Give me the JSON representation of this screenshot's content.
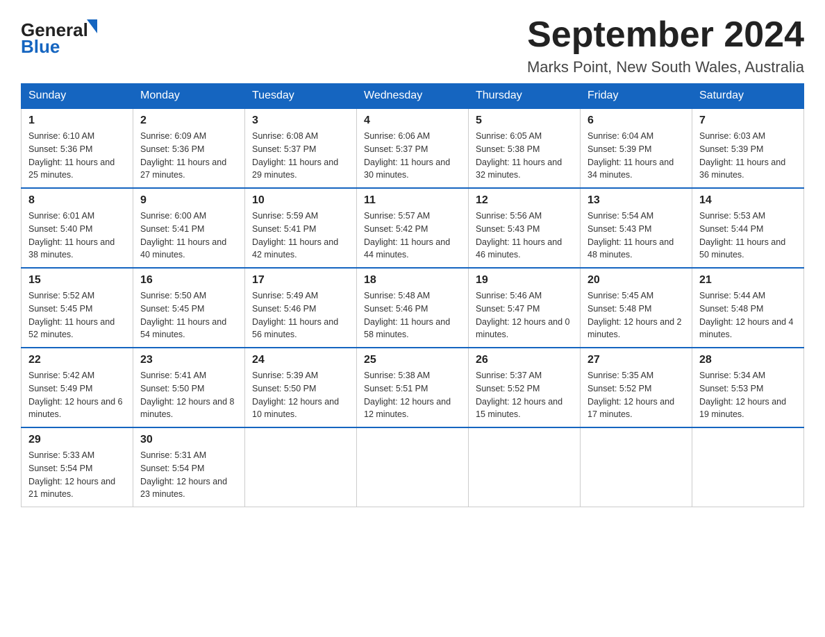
{
  "header": {
    "logo_general": "General",
    "logo_blue": "Blue",
    "month_title": "September 2024",
    "location": "Marks Point, New South Wales, Australia"
  },
  "weekdays": [
    "Sunday",
    "Monday",
    "Tuesday",
    "Wednesday",
    "Thursday",
    "Friday",
    "Saturday"
  ],
  "weeks": [
    [
      {
        "day": "1",
        "sunrise": "6:10 AM",
        "sunset": "5:36 PM",
        "daylight": "11 hours and 25 minutes."
      },
      {
        "day": "2",
        "sunrise": "6:09 AM",
        "sunset": "5:36 PM",
        "daylight": "11 hours and 27 minutes."
      },
      {
        "day": "3",
        "sunrise": "6:08 AM",
        "sunset": "5:37 PM",
        "daylight": "11 hours and 29 minutes."
      },
      {
        "day": "4",
        "sunrise": "6:06 AM",
        "sunset": "5:37 PM",
        "daylight": "11 hours and 30 minutes."
      },
      {
        "day": "5",
        "sunrise": "6:05 AM",
        "sunset": "5:38 PM",
        "daylight": "11 hours and 32 minutes."
      },
      {
        "day": "6",
        "sunrise": "6:04 AM",
        "sunset": "5:39 PM",
        "daylight": "11 hours and 34 minutes."
      },
      {
        "day": "7",
        "sunrise": "6:03 AM",
        "sunset": "5:39 PM",
        "daylight": "11 hours and 36 minutes."
      }
    ],
    [
      {
        "day": "8",
        "sunrise": "6:01 AM",
        "sunset": "5:40 PM",
        "daylight": "11 hours and 38 minutes."
      },
      {
        "day": "9",
        "sunrise": "6:00 AM",
        "sunset": "5:41 PM",
        "daylight": "11 hours and 40 minutes."
      },
      {
        "day": "10",
        "sunrise": "5:59 AM",
        "sunset": "5:41 PM",
        "daylight": "11 hours and 42 minutes."
      },
      {
        "day": "11",
        "sunrise": "5:57 AM",
        "sunset": "5:42 PM",
        "daylight": "11 hours and 44 minutes."
      },
      {
        "day": "12",
        "sunrise": "5:56 AM",
        "sunset": "5:43 PM",
        "daylight": "11 hours and 46 minutes."
      },
      {
        "day": "13",
        "sunrise": "5:54 AM",
        "sunset": "5:43 PM",
        "daylight": "11 hours and 48 minutes."
      },
      {
        "day": "14",
        "sunrise": "5:53 AM",
        "sunset": "5:44 PM",
        "daylight": "11 hours and 50 minutes."
      }
    ],
    [
      {
        "day": "15",
        "sunrise": "5:52 AM",
        "sunset": "5:45 PM",
        "daylight": "11 hours and 52 minutes."
      },
      {
        "day": "16",
        "sunrise": "5:50 AM",
        "sunset": "5:45 PM",
        "daylight": "11 hours and 54 minutes."
      },
      {
        "day": "17",
        "sunrise": "5:49 AM",
        "sunset": "5:46 PM",
        "daylight": "11 hours and 56 minutes."
      },
      {
        "day": "18",
        "sunrise": "5:48 AM",
        "sunset": "5:46 PM",
        "daylight": "11 hours and 58 minutes."
      },
      {
        "day": "19",
        "sunrise": "5:46 AM",
        "sunset": "5:47 PM",
        "daylight": "12 hours and 0 minutes."
      },
      {
        "day": "20",
        "sunrise": "5:45 AM",
        "sunset": "5:48 PM",
        "daylight": "12 hours and 2 minutes."
      },
      {
        "day": "21",
        "sunrise": "5:44 AM",
        "sunset": "5:48 PM",
        "daylight": "12 hours and 4 minutes."
      }
    ],
    [
      {
        "day": "22",
        "sunrise": "5:42 AM",
        "sunset": "5:49 PM",
        "daylight": "12 hours and 6 minutes."
      },
      {
        "day": "23",
        "sunrise": "5:41 AM",
        "sunset": "5:50 PM",
        "daylight": "12 hours and 8 minutes."
      },
      {
        "day": "24",
        "sunrise": "5:39 AM",
        "sunset": "5:50 PM",
        "daylight": "12 hours and 10 minutes."
      },
      {
        "day": "25",
        "sunrise": "5:38 AM",
        "sunset": "5:51 PM",
        "daylight": "12 hours and 12 minutes."
      },
      {
        "day": "26",
        "sunrise": "5:37 AM",
        "sunset": "5:52 PM",
        "daylight": "12 hours and 15 minutes."
      },
      {
        "day": "27",
        "sunrise": "5:35 AM",
        "sunset": "5:52 PM",
        "daylight": "12 hours and 17 minutes."
      },
      {
        "day": "28",
        "sunrise": "5:34 AM",
        "sunset": "5:53 PM",
        "daylight": "12 hours and 19 minutes."
      }
    ],
    [
      {
        "day": "29",
        "sunrise": "5:33 AM",
        "sunset": "5:54 PM",
        "daylight": "12 hours and 21 minutes."
      },
      {
        "day": "30",
        "sunrise": "5:31 AM",
        "sunset": "5:54 PM",
        "daylight": "12 hours and 23 minutes."
      },
      null,
      null,
      null,
      null,
      null
    ]
  ],
  "labels": {
    "sunrise": "Sunrise:",
    "sunset": "Sunset:",
    "daylight": "Daylight:"
  }
}
